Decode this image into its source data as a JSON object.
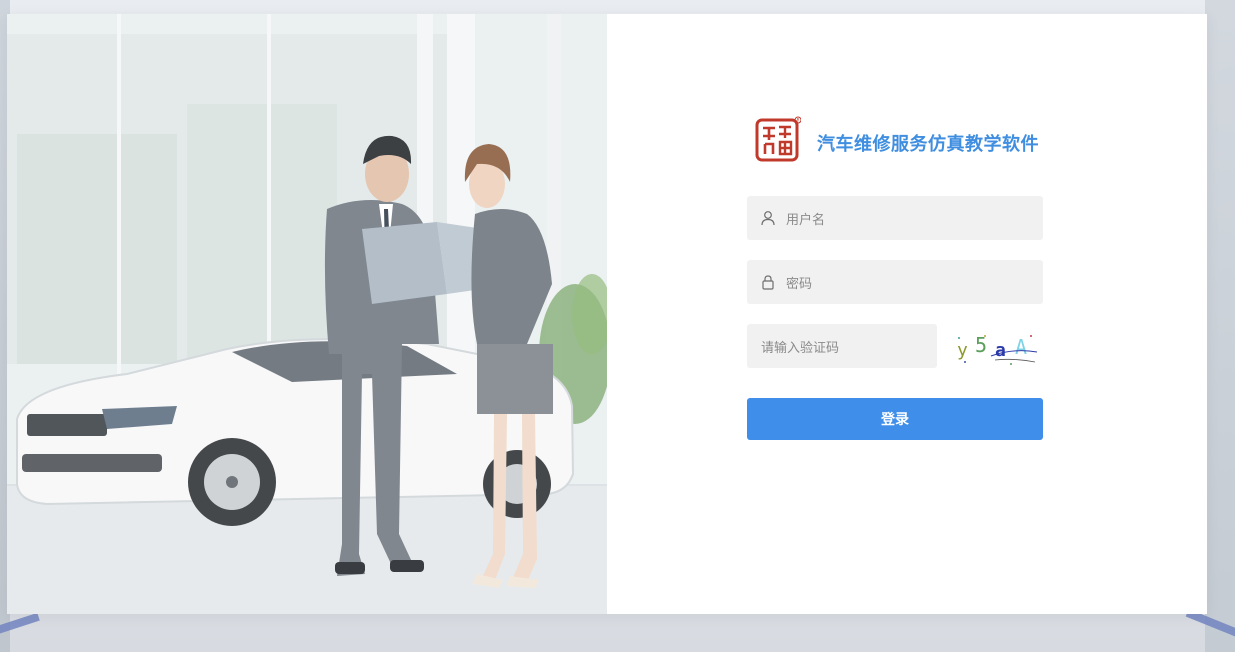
{
  "brand": {
    "logo_icon": "seal-logo-icon",
    "title": "汽车维修服务仿真教学软件",
    "accent_color": "#3f8ee0"
  },
  "form": {
    "username_placeholder": "用户名",
    "password_placeholder": "密码",
    "captcha_placeholder": "请输入验证码",
    "captcha_text": "y5aA",
    "login_label": "登录",
    "button_color": "#3f8ee9"
  },
  "icons": {
    "username": "user-icon",
    "password": "lock-icon"
  }
}
